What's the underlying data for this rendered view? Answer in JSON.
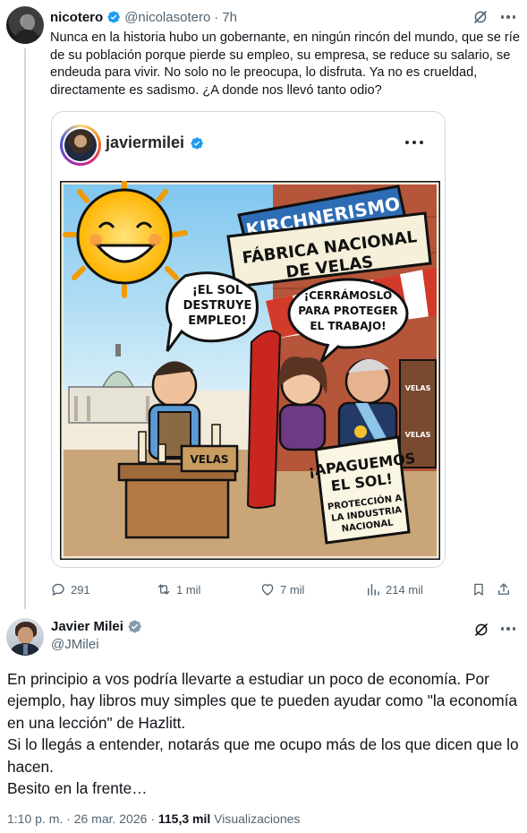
{
  "tweet1": {
    "author_name": "nicotero",
    "handle": "@nicolasotero",
    "separator": "·",
    "time": "7h",
    "text": "Nunca en la historia hubo un gobernante, en ningún rincón del mundo, que se ríe de su población porque pierde su empleo, su empresa, se reduce su salario, se endeuda para vivir. No solo no le preocupa, lo disfruta. Ya no es crueldad, directamente es sadismo. ¿A donde nos llevó tanto odio?",
    "embed": {
      "account_name": "javiermilei",
      "comic": {
        "sign_top": "KIRCHNERISMO",
        "sign_line1": "FÁBRICA NACIONAL",
        "sign_line2": "DE VELAS",
        "bubble_left_1": "¡EL SOL",
        "bubble_left_2": "DESTRUYE",
        "bubble_left_3": "EMPLEO!",
        "bubble_right_1": "¡CERRÁMOSLO",
        "bubble_right_2": "PARA PROTEGER",
        "bubble_right_3": "EL TRABAJO!",
        "box_label": "VELAS",
        "shelf_label": "VELAS",
        "shelf_label2": "VELAS",
        "placard_1": "¡APAGUEMOS",
        "placard_2": "EL SOL!",
        "placard_3": "PROTECCIÓN A",
        "placard_4": "LA INDUSTRIA",
        "placard_5": "NACIONAL"
      }
    },
    "actions": {
      "replies": "291",
      "reposts": "1 mil",
      "likes": "7 mil",
      "views": "214 mil"
    }
  },
  "tweet2": {
    "author_name": "Javier Milei",
    "handle": "@JMilei",
    "paragraphs": [
      "En principio a vos podría llevarte a estudiar un poco de economía. Por ejemplo, hay libros muy simples que te pueden ayudar como \"la economía en una lección\" de Hazlitt.",
      "Si lo llegás a entender, notarás que me ocupo más de los que dicen que lo hacen.",
      "Besito en la frente…"
    ],
    "meta": {
      "time_date": "1:10 p. m. · 26 mar. 2026 ·",
      "views_count": "115,3 mil",
      "views_label": "Visualizaciones"
    }
  },
  "colors": {
    "verified_blue": "#1d9bf0",
    "secondary_text": "#536471",
    "primary_text": "#0f1419",
    "border": "#cfd9de"
  }
}
